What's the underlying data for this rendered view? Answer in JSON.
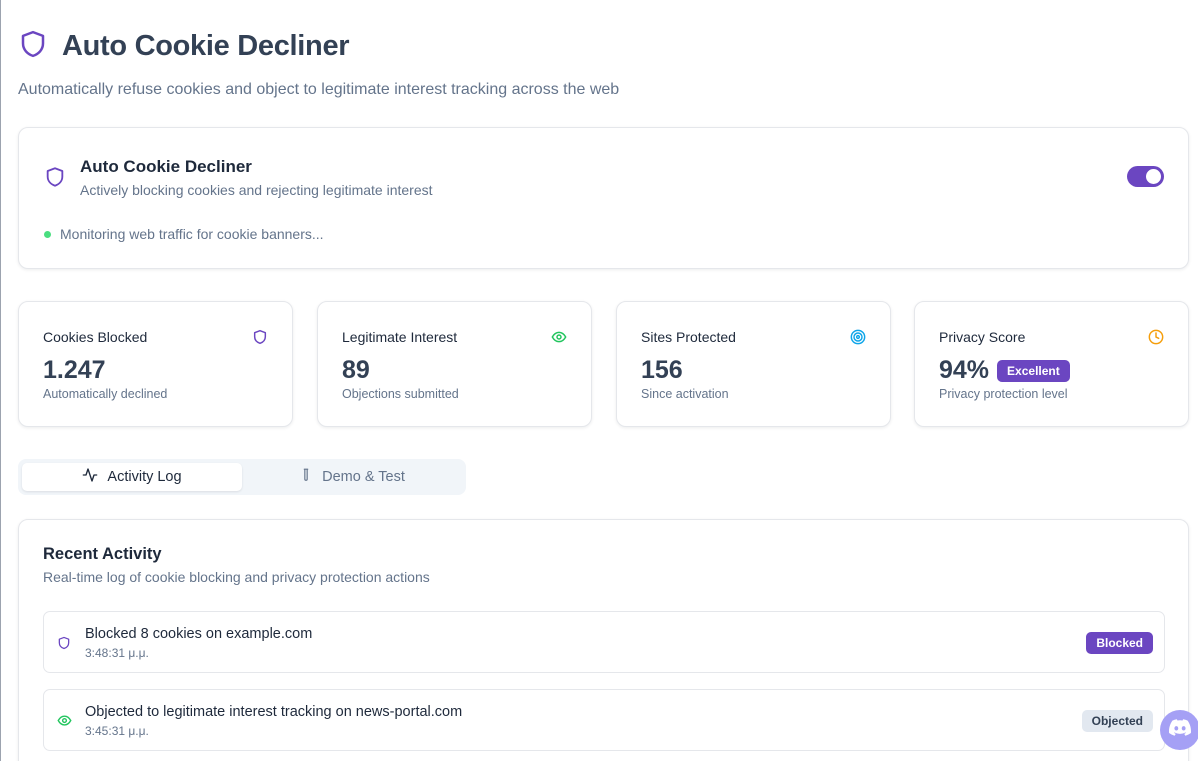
{
  "header": {
    "title": "Auto Cookie Decliner",
    "subtitle": "Automatically refuse cookies and object to legitimate interest tracking across the web",
    "icon": "shield-icon"
  },
  "main_card": {
    "title": "Auto Cookie Decliner",
    "subtitle": "Actively blocking cookies and rejecting legitimate interest",
    "status": "Monitoring web traffic for cookie banners...",
    "toggle_on": true
  },
  "stats": [
    {
      "label": "Cookies Blocked",
      "value": "1.247",
      "desc": "Automatically declined",
      "icon": "shield-icon",
      "color": "#6b46c1"
    },
    {
      "label": "Legitimate Interest",
      "value": "89",
      "desc": "Objections submitted",
      "icon": "eye-icon",
      "color": "#22c55e"
    },
    {
      "label": "Sites Protected",
      "value": "156",
      "desc": "Since activation",
      "icon": "target-icon",
      "color": "#0ea5e9"
    },
    {
      "label": "Privacy Score",
      "value": "94%",
      "badge": "Excellent",
      "desc": "Privacy protection level",
      "icon": "clock-icon",
      "color": "#f59e0b"
    }
  ],
  "tabs": [
    {
      "label": "Activity Log",
      "icon": "activity-icon",
      "active": true
    },
    {
      "label": "Demo & Test",
      "icon": "test-tube-icon",
      "active": false
    }
  ],
  "activity": {
    "title": "Recent Activity",
    "subtitle": "Real-time log of cookie blocking and privacy protection actions",
    "items": [
      {
        "text": "Blocked 8 cookies on example.com",
        "time": "3:48:31 μ.μ.",
        "badge": "Blocked",
        "icon": "shield-icon"
      },
      {
        "text": "Objected to legitimate interest tracking on news-portal.com",
        "time": "3:45:31 μ.μ.",
        "badge": "Objected",
        "icon": "eye-icon"
      }
    ]
  },
  "colors": {
    "accent": "#6b46c1",
    "status_green": "#4ade80"
  }
}
